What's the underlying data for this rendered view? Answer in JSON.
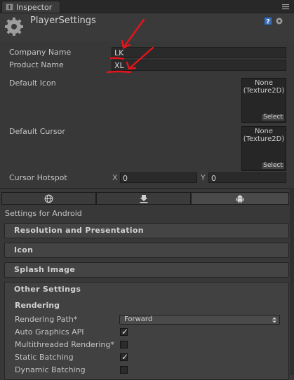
{
  "tab": {
    "label": "Inspector"
  },
  "header": {
    "title": "PlayerSettings"
  },
  "fields": {
    "company_label": "Company Name",
    "company_value": "LK",
    "product_label": "Product Name",
    "product_value": "XL",
    "default_icon_label": "Default Icon",
    "default_cursor_label": "Default Cursor",
    "texture_none": "None",
    "texture_type": "(Texture2D)",
    "select_label": "Select",
    "cursor_hotspot_label": "Cursor Hotspot",
    "hotspot_x_label": "X",
    "hotspot_x_value": "0",
    "hotspot_y_label": "Y",
    "hotspot_y_value": "0"
  },
  "platform_tabs": [
    {
      "icon": "globe-icon",
      "active": false
    },
    {
      "icon": "download-icon",
      "active": false
    },
    {
      "icon": "android-icon",
      "active": true
    }
  ],
  "settings_for": "Settings for Android",
  "sections": {
    "resolution": "Resolution and Presentation",
    "icon": "Icon",
    "splash": "Splash Image",
    "other": "Other Settings"
  },
  "rendering": {
    "heading": "Rendering",
    "path_label": "Rendering Path*",
    "path_value": "Forward",
    "auto_graphics_label": "Auto Graphics API",
    "auto_graphics_checked": true,
    "multithreaded_label": "Multithreaded Rendering*",
    "multithreaded_checked": false,
    "static_batching_label": "Static Batching",
    "static_batching_checked": true,
    "dynamic_batching_label": "Dynamic Batching",
    "dynamic_batching_checked": false
  },
  "colors": {
    "annotation": "#e6141a",
    "background": "#383838"
  }
}
